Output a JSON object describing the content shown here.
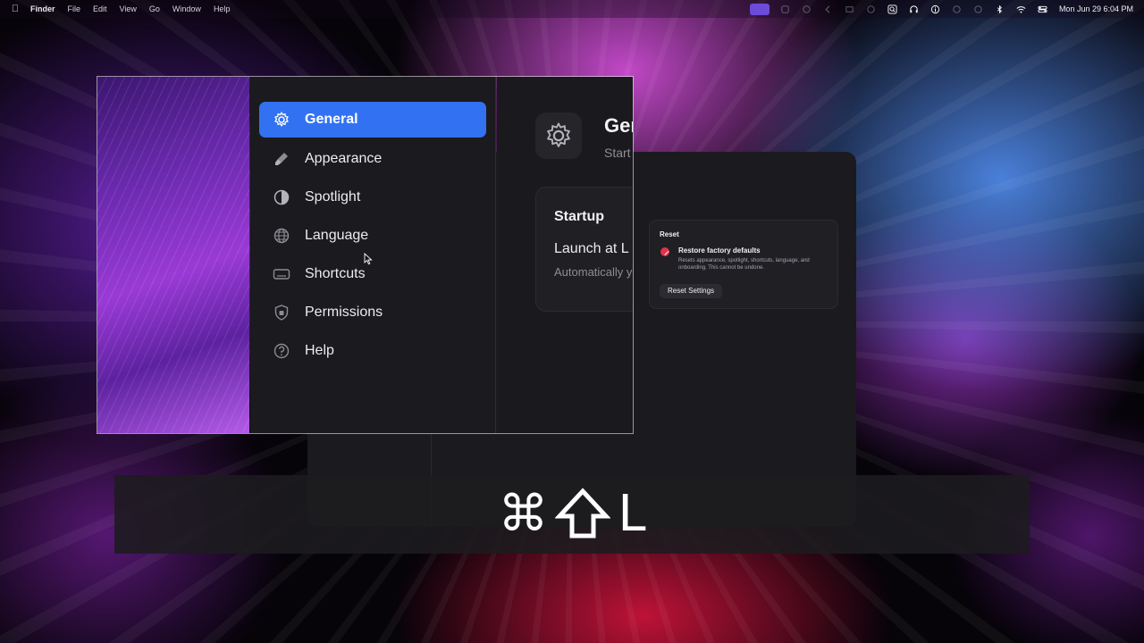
{
  "menubar": {
    "app_name": "Finder",
    "items": [
      "File",
      "Edit",
      "View",
      "Go",
      "Window",
      "Help"
    ],
    "clock": "Mon Jun 29  6:04 PM"
  },
  "sidebar": {
    "items": [
      {
        "label": "General",
        "icon": "gear-icon",
        "active": true
      },
      {
        "label": "Appearance",
        "icon": "brush-icon",
        "active": false
      },
      {
        "label": "Spotlight",
        "icon": "half-circle-icon",
        "active": false
      },
      {
        "label": "Language",
        "icon": "globe-icon",
        "active": false
      },
      {
        "label": "Shortcuts",
        "icon": "keyboard-icon",
        "active": false
      },
      {
        "label": "Permissions",
        "icon": "shield-icon",
        "active": false
      },
      {
        "label": "Help",
        "icon": "question-icon",
        "active": false
      }
    ]
  },
  "main": {
    "title": "Ger",
    "subtitle": "Start",
    "startup": {
      "heading": "Startup",
      "title": "Launch at L",
      "description": "Automatically you sign in to"
    }
  },
  "reset_card": {
    "heading": "Reset",
    "title": "Restore factory defaults",
    "description": "Resets appearance, spotlight, shortcuts, language, and onboarding. This cannot be undone.",
    "button": "Reset Settings"
  },
  "shortcut": {
    "keys": [
      "⌘",
      "⇧",
      "L"
    ]
  },
  "colors": {
    "accent": "#3272f2",
    "danger": "#e0324a",
    "window_bg": "#1b1a1e"
  }
}
